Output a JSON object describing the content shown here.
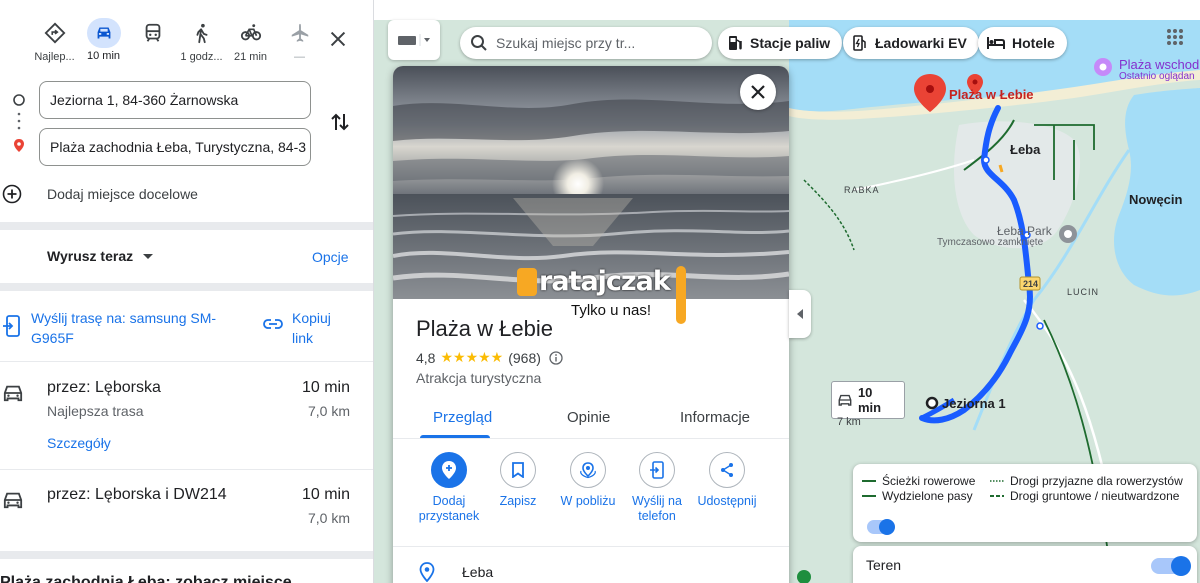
{
  "directions": {
    "modes": [
      {
        "name": "recommended",
        "label": "Najlep..."
      },
      {
        "name": "car",
        "label": "10 min"
      },
      {
        "name": "transit",
        "label": ""
      },
      {
        "name": "walk",
        "label": "1 godz..."
      },
      {
        "name": "bike",
        "label": "21 min"
      },
      {
        "name": "flight",
        "label": "—"
      }
    ],
    "origin": "Jeziorna 1, 84-360 Żarnowska",
    "destination": "Plaża zachodnia Łeba, Turystyczna, 84-3",
    "add_destination": "Dodaj miejsce docelowe",
    "depart_label": "Wyrusz teraz",
    "options_label": "Opcje",
    "send_route": "Wyślij trasę na: samsung SM-G965F",
    "copy_link": "Kopiuj link",
    "routes": [
      {
        "via": "przez: Lęborska",
        "sub": "Najlepsza trasa",
        "duration": "10 min",
        "distance": "7,0 km",
        "details": "Szczegóły"
      },
      {
        "via": "przez: Lęborska i DW214",
        "sub": "",
        "duration": "10 min",
        "distance": "7,0 km"
      }
    ],
    "bottom_text": "Plaża zachodnia Łeba: zobacz miejsce"
  },
  "map": {
    "search_placeholder": "Szukaj miejsc przy tr...",
    "chips": [
      "Stacje paliw",
      "Ładowarki EV",
      "Hotele"
    ],
    "labels": {
      "plaza_pin": "Plaża w Łebie",
      "leba": "Łeba",
      "nowecin": "Nowęcin",
      "rabka": "RABKA",
      "leba_park": "Łeba Park",
      "leba_park_sub": "Tymczasowo zamknięte",
      "lucin": "LUCIN",
      "road_214": "214",
      "jeziorna": "Jeziorna 1",
      "plaza_wschodnia": "Plaża wschod",
      "plaza_wschodnia_sub": "Ostatnio oglądan"
    },
    "route_box": {
      "duration": "10 min",
      "distance": "7 km"
    },
    "legend": {
      "items": [
        "Ścieżki rowerowe",
        "Drogi przyjazne dla rowerzystów",
        "Wydzielone pasy",
        "Drogi gruntowe / nieutwardzone"
      ]
    },
    "terrain_label": "Teren"
  },
  "place": {
    "title": "Plaża w Łebie",
    "rating": "4,8",
    "stars": "★★★★★",
    "reviews": "(968)",
    "category": "Atrakcja turystyczna",
    "tabs": [
      "Przegląd",
      "Opinie",
      "Informacje"
    ],
    "actions": [
      "Dodaj przystanek",
      "Zapisz",
      "W pobliżu",
      "Wyślij na telefon",
      "Udostępnij"
    ],
    "location": "Łeba",
    "watermark_logo": "ratajczak",
    "watermark_sub": "Tylko u nas!"
  },
  "colors": {
    "accent": "#1a73e8",
    "route": "#1a5cff",
    "star": "#fbbc04",
    "pin": "#ea4335",
    "water": "#a4ddf7",
    "land": "#d4e6dc"
  }
}
